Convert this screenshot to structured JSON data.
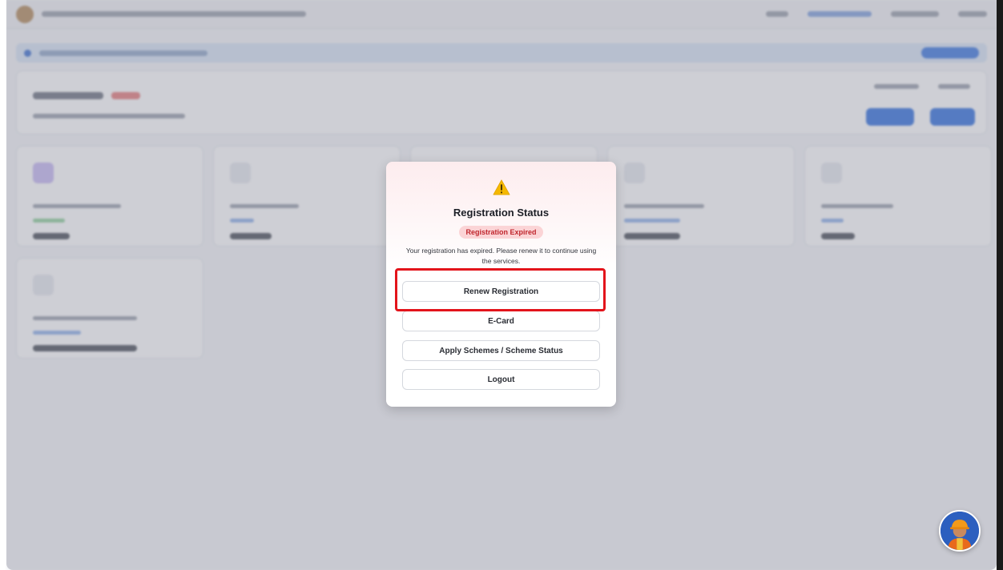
{
  "modal": {
    "icon": "warning-icon",
    "title": "Registration Status",
    "status_badge": "Registration Expired",
    "message": "Your registration has expired. Please renew it to continue using the services.",
    "buttons": {
      "renew": "Renew Registration",
      "ecard": "E-Card",
      "apply": "Apply Schemes / Scheme Status",
      "logout": "Logout"
    }
  },
  "chat": {
    "icon": "worker-avatar-icon"
  },
  "colors": {
    "accent": "#2f6fde",
    "badge_bg": "#fbd4d6",
    "badge_text": "#c0262d",
    "highlight": "#e3141b",
    "warning": "#f5b800"
  }
}
